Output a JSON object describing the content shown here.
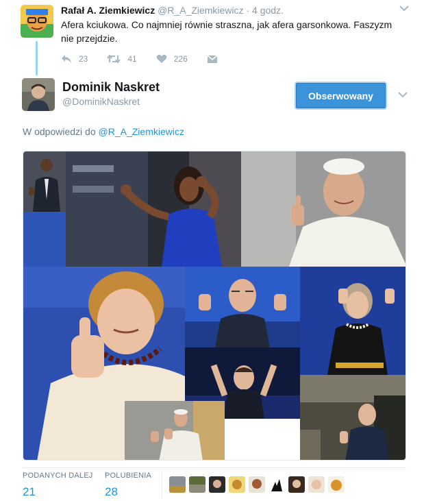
{
  "parent_tweet": {
    "name": "Rafał A. Ziemkiewicz",
    "handle": "@R_A_Ziemkiewicz",
    "separator": "·",
    "time": "4 godz.",
    "text": "Afera kciukowa. Co najmniej równie straszna, jak afera garsonkowa. Faszyzm nie przejdzie.",
    "replies": "23",
    "retweets": "41",
    "likes": "226"
  },
  "tweet": {
    "name": "Dominik Naskret",
    "handle": "@DominikNaskret",
    "follow_label": "Obserwowany",
    "reply_prefix": "W odpowiedzi do",
    "reply_to": "@R_A_Ziemkiewicz"
  },
  "stats": {
    "retweets_label": "PODANYCH DALEJ",
    "retweets_value": "21",
    "likes_label": "POLUBIENIA",
    "likes_value": "28",
    "liker_avatar_count": 9
  },
  "colors": {
    "link": "#1b95e0",
    "follow_button": "#3b94d9",
    "thread_line": "#9ad0f0",
    "muted": "#8899a6"
  },
  "icons": [
    "reply-icon",
    "retweet-icon",
    "heart-icon",
    "dm-icon",
    "chevron-down-icon"
  ]
}
